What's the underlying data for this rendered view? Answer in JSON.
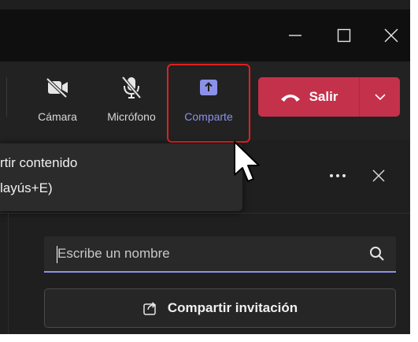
{
  "toolbar": {
    "camera_label": "Cámara",
    "mic_label": "Micrófono",
    "share_label": "Comparte",
    "leave_label": "Salir"
  },
  "tooltip": {
    "line1": "rtir contenido",
    "line2": "layús+E)"
  },
  "search": {
    "placeholder": "Escribe un nombre"
  },
  "invite": {
    "label": "Compartir invitación"
  },
  "colors": {
    "accent": "#8b91e8",
    "leave": "#c4314b",
    "highlight_border": "#e02020"
  },
  "icons": [
    "minimize-icon",
    "maximize-icon",
    "close-icon",
    "camera-off-icon",
    "mic-off-icon",
    "share-screen-icon",
    "phone-hangup-icon",
    "chevron-down-icon",
    "more-icon",
    "search-icon",
    "share-link-icon",
    "mouse-pointer-icon"
  ]
}
